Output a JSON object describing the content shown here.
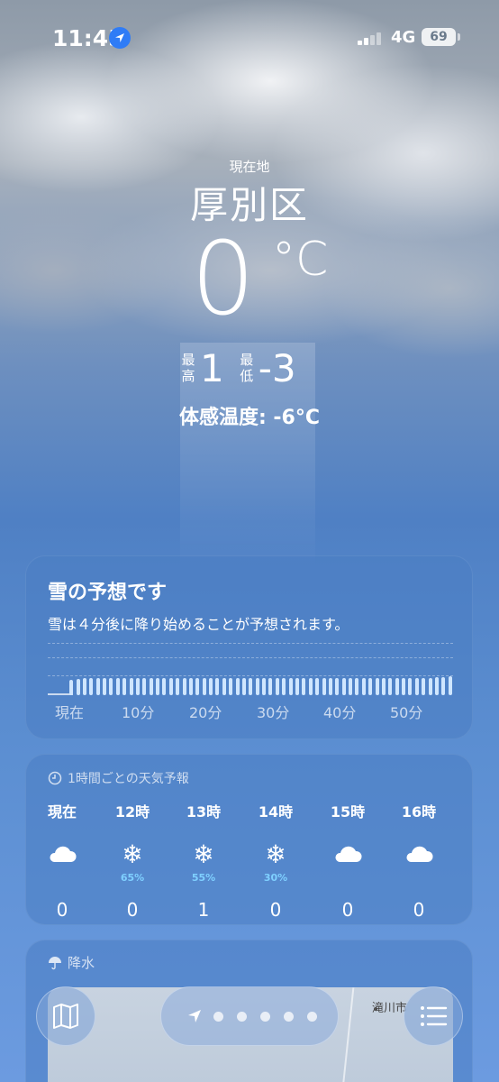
{
  "status_bar": {
    "time": "11:45",
    "network": "4G",
    "battery": "69"
  },
  "header": {
    "location_label": "現在地",
    "city": "厚別区",
    "temperature": "0",
    "unit": "°C",
    "high_label": "最高",
    "high_value": "1",
    "low_label": "最低",
    "low_value": "-3",
    "feels_like": "体感温度: -6°C"
  },
  "snow_forecast": {
    "title": "雪の予想です",
    "description": "雪は４分後に降り始めることが予想されます。",
    "ticks": [
      "現在",
      "10分",
      "20分",
      "30分",
      "40分",
      "50分"
    ],
    "intensity_levels": [
      0.0,
      0.0,
      0.0,
      0.65,
      0.7,
      0.72,
      0.72,
      0.72,
      0.72,
      0.72,
      0.72,
      0.72,
      0.72,
      0.72,
      0.72,
      0.72,
      0.72,
      0.72,
      0.72,
      0.72,
      0.72,
      0.72,
      0.72,
      0.72,
      0.72,
      0.72,
      0.72,
      0.72,
      0.72,
      0.72,
      0.72,
      0.72,
      0.72,
      0.72,
      0.72,
      0.72,
      0.72,
      0.72,
      0.72,
      0.72,
      0.72,
      0.72,
      0.72,
      0.72,
      0.72,
      0.72,
      0.72,
      0.72,
      0.72,
      0.72,
      0.72,
      0.72,
      0.72,
      0.72,
      0.72,
      0.72,
      0.74,
      0.74,
      0.76,
      0.78,
      0.8
    ]
  },
  "hourly": {
    "header": "1時間ごとの天気予報",
    "items": [
      {
        "label": "現在",
        "icon": "cloud-icon",
        "pct": "",
        "value": "0"
      },
      {
        "label": "12時",
        "icon": "snowflake-icon",
        "pct": "65%",
        "value": "0"
      },
      {
        "label": "13時",
        "icon": "snowflake-icon",
        "pct": "55%",
        "value": "1"
      },
      {
        "label": "14時",
        "icon": "snowflake-icon",
        "pct": "30%",
        "value": "0"
      },
      {
        "label": "15時",
        "icon": "cloud-icon",
        "pct": "",
        "value": "0"
      },
      {
        "label": "16時",
        "icon": "cloud-icon",
        "pct": "",
        "value": "0"
      }
    ]
  },
  "precipitation": {
    "header": "降水",
    "map_city": "滝川市"
  },
  "pager": {
    "pages": 5
  }
}
